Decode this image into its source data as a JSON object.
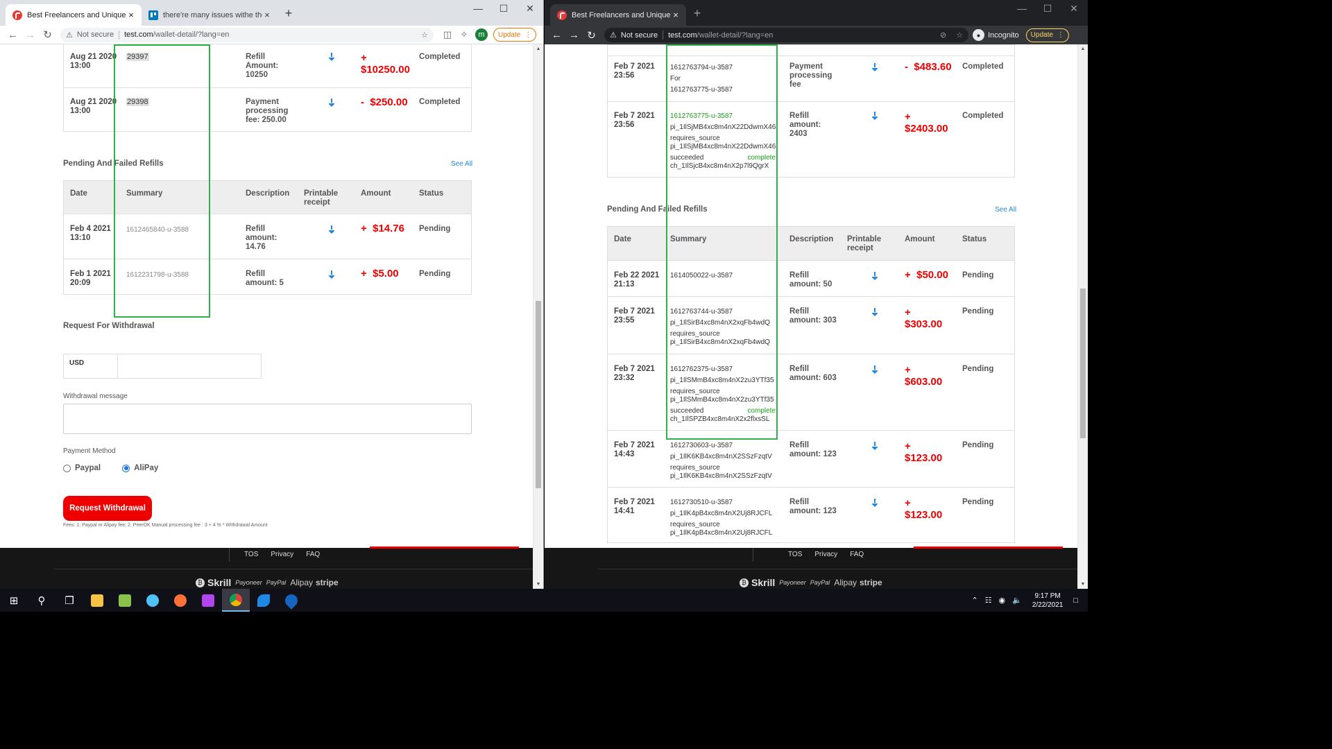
{
  "left": {
    "tabs": [
      {
        "title": "Best Freelancers and Unique Con",
        "close": "×"
      },
      {
        "title": "there're many issues withe the W",
        "close": "×"
      }
    ],
    "new_tab": "+",
    "address": {
      "security": "Not secure",
      "host": "test.com",
      "path": "/wallet-detail/?lang=en"
    },
    "avatar_letter": "m",
    "update_label": "Update",
    "top_rows": [
      {
        "date": "Aug 21 2020\n13:00",
        "summary": "29397",
        "desc": "Refill\nAmount:\n10250",
        "sign": "+",
        "amount": "$10250.00",
        "status": "Completed"
      },
      {
        "date": "Aug 21 2020\n13:00",
        "summary": "29398",
        "desc": "Payment\nprocessing\nfee: 250.00",
        "sign": "-",
        "amount": "$250.00",
        "status": "Completed"
      }
    ],
    "pending_title": "Pending And Failed Refills",
    "see_all": "See All",
    "headers": {
      "date": "Date",
      "summary": "Summary",
      "description": "Description",
      "receipt": "Printable\nreceipt",
      "amount": "Amount",
      "status": "Status"
    },
    "pending_rows": [
      {
        "date": "Feb 4 2021\n13:10",
        "summary": "1612465840-u-3588",
        "desc": "Refill\namount:\n14.76",
        "sign": "+",
        "amount": "$14.76",
        "status": "Pending"
      },
      {
        "date": "Feb 1 2021\n20:09",
        "summary": "1612231798-u-3588",
        "desc": "Refill\namount: 5",
        "sign": "+",
        "amount": "$5.00",
        "status": "Pending"
      }
    ],
    "withdrawal": {
      "title": "Request For Withdrawal",
      "currency": "USD",
      "amount_value": "",
      "message_label": "Withdrawal message",
      "message_value": "",
      "method_label": "Payment Method",
      "method_paypal": "Paypal",
      "method_alipay": "AliPay",
      "selected": "AliPay",
      "button": "Request Withdrawal",
      "fees": "Fees: 1. Paypal or Alipay fee; 2. PeerOK Manual processing fee : 3 + 4 % * Withdrawal Amount"
    }
  },
  "right": {
    "tabs": [
      {
        "title": "Best Freelancers and Unique Con",
        "close": "×"
      }
    ],
    "new_tab": "+",
    "address": {
      "security": "Not secure",
      "host": "test.com",
      "path": "/wallet-detail/?lang=en"
    },
    "incognito_label": "Incognito",
    "update_label": "Update",
    "top_rows": [
      {
        "date": "Feb 7 2021\n23:56",
        "summary": [
          "1612763794-u-3587",
          "For",
          "1612763775-u-3587"
        ],
        "desc": "Payment\nprocessing\nfee",
        "sign": "-",
        "amount": "$483.60",
        "status": "Completed"
      },
      {
        "date": "Feb 7 2021\n23:56",
        "summary": [
          "1612763775-u-3587",
          "pi_1IlSjMB4xc8m4nX22DdwmX46",
          "requires_source",
          "pi_1IlSjMB4xc8m4nX22DdwmX46",
          "succeeded",
          "complete",
          "ch_1IlSjcB4xc8m4nX2p7l9QgrX"
        ],
        "desc": "Refill\namount:\n2403",
        "sign": "+",
        "amount": "$2403.00",
        "status": "Completed"
      }
    ],
    "pending_title": "Pending And Failed Refills",
    "see_all": "See All",
    "headers": {
      "date": "Date",
      "summary": "Summary",
      "description": "Description",
      "receipt": "Printable\nreceipt",
      "amount": "Amount",
      "status": "Status"
    },
    "pending_rows": [
      {
        "date": "Feb 22 2021\n21:13",
        "summary": [
          "1614050022-u-3587"
        ],
        "desc": "Refill\namount: 50",
        "sign": "+",
        "amount": "$50.00",
        "status": "Pending"
      },
      {
        "date": "Feb 7 2021\n23:55",
        "summary": [
          "1612763744-u-3587",
          "pi_1IlSirB4xc8m4nX2xqFb4wdQ",
          "requires_source",
          "pi_1IlSirB4xc8m4nX2xqFb4wdQ"
        ],
        "desc": "Refill\namount: 303",
        "sign": "+",
        "amount": "$303.00",
        "status": "Pending"
      },
      {
        "date": "Feb 7 2021\n23:32",
        "summary": [
          "1612762375-u-3587",
          "pi_1IlSMmB4xc8m4nX2zu3YTf35",
          "requires_source",
          "pi_1IlSMmB4xc8m4nX2zu3YTf35",
          "succeeded",
          "complete",
          "ch_1IlSPZB4xc8m4nX2x2flxsSL"
        ],
        "desc": "Refill\namount: 603",
        "sign": "+",
        "amount": "$603.00",
        "status": "Pending"
      },
      {
        "date": "Feb 7 2021\n14:43",
        "summary": [
          "1612730603-u-3587",
          "pi_1IlK6KB4xc8m4nX2SSzFzqtV",
          "requires_source",
          "pi_1IlK6KB4xc8m4nX2SSzFzqtV"
        ],
        "desc": "Refill\namount: 123",
        "sign": "+",
        "amount": "$123.00",
        "status": "Pending"
      },
      {
        "date": "Feb 7 2021\n14:41",
        "summary": [
          "1612730510-u-3587",
          "pi_1IlK4pB4xc8m4nX2Uj8RJCFL",
          "requires_source",
          "pi_1IlK4pB4xc8m4nX2Uj8RJCFL"
        ],
        "desc": "Refill\namount: 123",
        "sign": "+",
        "amount": "$123.00",
        "status": "Pending"
      }
    ]
  },
  "footer": {
    "links": [
      "TOS",
      "Privacy",
      "FAQ"
    ],
    "payments": [
      "Skrill",
      "Payoneer",
      "PayPal",
      "Alipay",
      "stripe"
    ]
  },
  "taskbar": {
    "time": "9:17 PM",
    "date": "2/22/2021"
  },
  "colors": {
    "accent_red": "#ee0000",
    "link_blue": "#1e88e5",
    "highlight_green": "#2fb04a"
  }
}
